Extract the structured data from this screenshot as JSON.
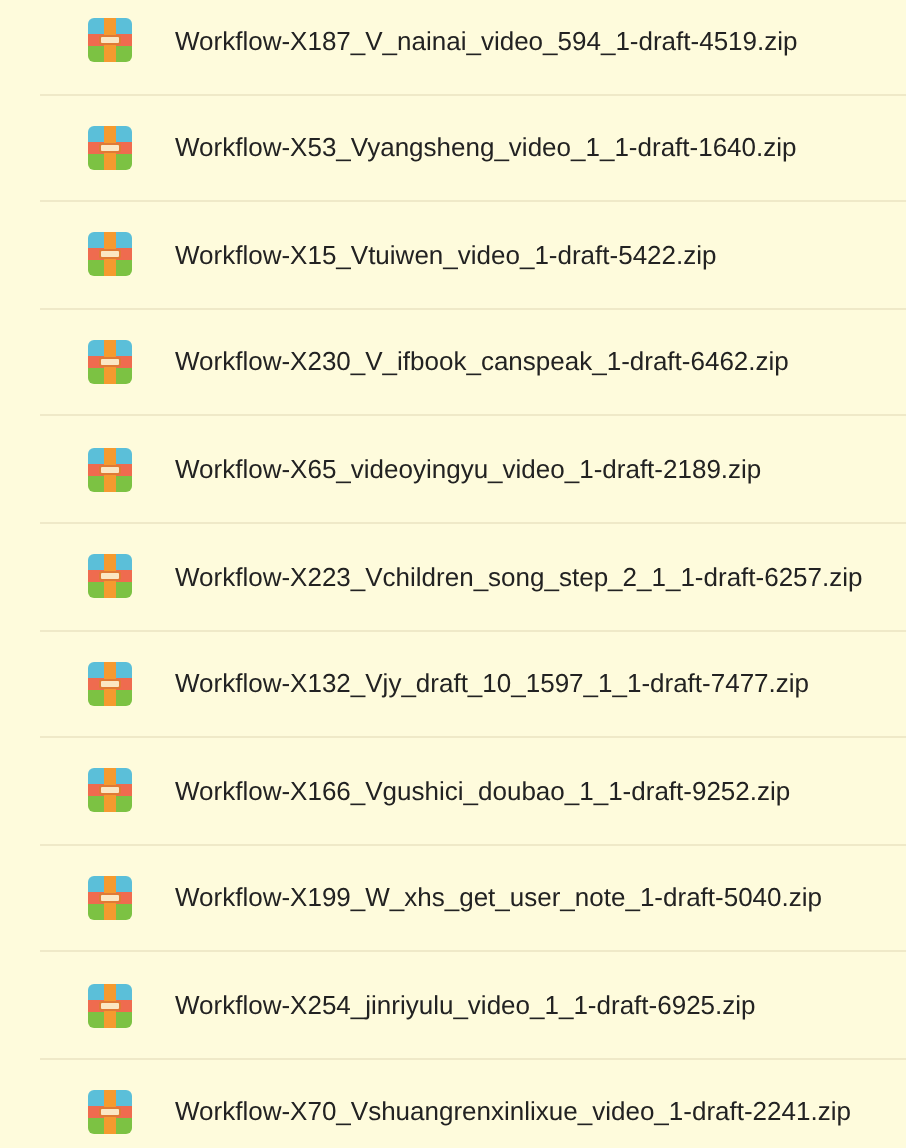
{
  "files": [
    {
      "name": "Workflow-X187_V_nainai_video_594_1-draft-4519.zip"
    },
    {
      "name": "Workflow-X53_Vyangsheng_video_1_1-draft-1640.zip"
    },
    {
      "name": "Workflow-X15_Vtuiwen_video_1-draft-5422.zip"
    },
    {
      "name": "Workflow-X230_V_ifbook_canspeak_1-draft-6462.zip"
    },
    {
      "name": "Workflow-X65_videoyingyu_video_1-draft-2189.zip"
    },
    {
      "name": "Workflow-X223_Vchildren_song_step_2_1_1-draft-6257.zip"
    },
    {
      "name": "Workflow-X132_Vjy_draft_10_1597_1_1-draft-7477.zip"
    },
    {
      "name": "Workflow-X166_Vgushici_doubao_1_1-draft-9252.zip"
    },
    {
      "name": "Workflow-X199_W_xhs_get_user_note_1-draft-5040.zip"
    },
    {
      "name": "Workflow-X254_jinriyulu_video_1_1-draft-6925.zip"
    },
    {
      "name": "Workflow-X70_Vshuangrenxinlixue_video_1-draft-2241.zip"
    }
  ]
}
